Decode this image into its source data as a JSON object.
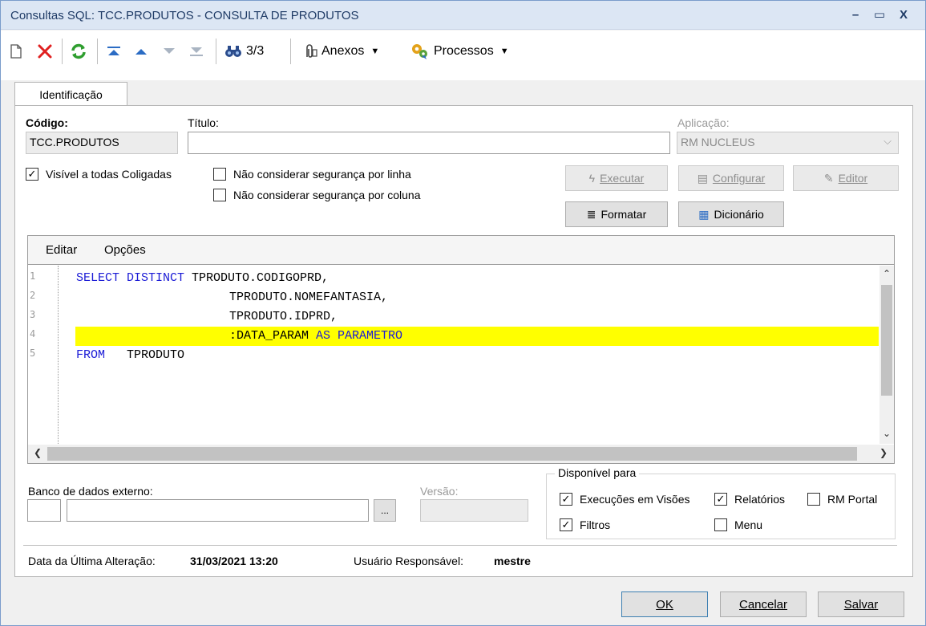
{
  "window": {
    "title": "Consultas SQL: TCC.PRODUTOS - CONSULTA DE PRODUTOS",
    "controls": {
      "minimize": "–",
      "maximize": "▭",
      "close": "X"
    }
  },
  "toolbar": {
    "record_counter": "3/3",
    "anexos_label": "Anexos",
    "processos_label": "Processos"
  },
  "tab": {
    "label": "Identificação"
  },
  "form": {
    "codigo_label": "Código:",
    "codigo_value": "TCC.PRODUTOS",
    "titulo_label": "Título:",
    "titulo_value": "",
    "aplicacao_label": "Aplicação:",
    "aplicacao_value": "RM NUCLEUS",
    "visivel_label": "Visível a todas Coligadas",
    "visivel_checked": true,
    "seg_linha_label": "Não considerar segurança por linha",
    "seg_linha_checked": false,
    "seg_coluna_label": "Não considerar segurança por coluna",
    "seg_coluna_checked": false
  },
  "actions": {
    "executar": "Executar",
    "configurar": "Configurar",
    "editor": "Editor",
    "formatar": "Formatar",
    "dicionario": "Dicionário"
  },
  "editor": {
    "menu": [
      "Editar",
      "Opções"
    ],
    "line_numbers": [
      "1",
      "2",
      "3",
      "4",
      "5"
    ],
    "lines": [
      {
        "kw": "SELECT DISTINCT",
        "text": " TPRODUTO.CODIGOPRD,"
      },
      {
        "kw": "",
        "text": "TPRODUTO.NOMEFANTASIA,"
      },
      {
        "kw": "",
        "text": "TPRODUTO.IDPRD,"
      },
      {
        "kw": "",
        "text": ":DATA_PARAM",
        "kw2": " AS PARAMETRO"
      },
      {
        "kw": "FROM",
        "text": "   TPRODUTO"
      }
    ],
    "highlighted_line": 4
  },
  "bottom": {
    "banco_label": "Banco de dados externo:",
    "banco_code": "",
    "banco_value": "",
    "browse_label": "...",
    "versao_label": "Versão:",
    "versao_value": "",
    "disponivel_legend": "Disponível para",
    "exec_visoes_label": "Execuções em Visões",
    "relatorios_label": "Relatórios",
    "rm_portal_label": "RM Portal",
    "filtros_label": "Filtros",
    "menu_label": "Menu",
    "exec_visoes_checked": true,
    "relatorios_checked": true,
    "rm_portal_checked": false,
    "filtros_checked": true,
    "menu_checked": false
  },
  "footer": {
    "data_label": "Data da Última Alteração:",
    "data_value": "31/03/2021 13:20",
    "usuario_label": "Usuário Responsável:",
    "usuario_value": "mestre"
  },
  "dialog": {
    "ok": "OK",
    "cancelar": "Cancelar",
    "salvar": "Salvar"
  },
  "colors": {
    "keyword": "#1c1cd6",
    "highlight": "#ffff00",
    "titlebar": "#dce6f4",
    "delete_icon": "#e02020",
    "refresh_icon": "#2f9e2f",
    "nav_icon": "#2b6cc4"
  }
}
